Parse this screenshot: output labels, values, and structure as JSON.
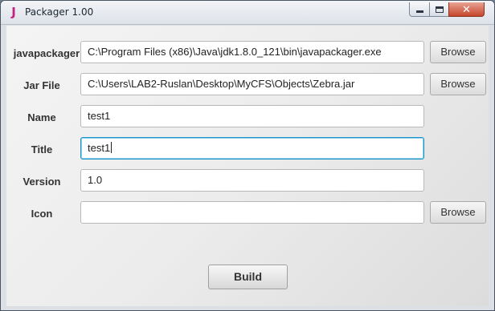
{
  "window": {
    "title": "Packager 1.00",
    "app_icon_glyph": "J",
    "controls": {
      "minimize": "minimize-icon",
      "maximize": "maximize-icon",
      "close_glyph": "✕"
    }
  },
  "form": {
    "javapackager": {
      "label": "javapackager",
      "value": "C:\\Program Files (x86)\\Java\\jdk1.8.0_121\\bin\\javapackager.exe",
      "browse_label": "Browse"
    },
    "jar_file": {
      "label": "Jar File",
      "value": "C:\\Users\\LAB2-Ruslan\\Desktop\\MyCFS\\Objects\\Zebra.jar",
      "browse_label": "Browse"
    },
    "name": {
      "label": "Name",
      "value": "test1"
    },
    "title": {
      "label": "Title",
      "value": "test1"
    },
    "version": {
      "label": "Version",
      "value": "1.0"
    },
    "icon": {
      "label": "Icon",
      "value": "",
      "browse_label": "Browse"
    }
  },
  "actions": {
    "build_label": "Build"
  },
  "colors": {
    "accent_focus": "#1a93c6",
    "app_icon": "#c2237f",
    "close_button": "#c6462c"
  }
}
